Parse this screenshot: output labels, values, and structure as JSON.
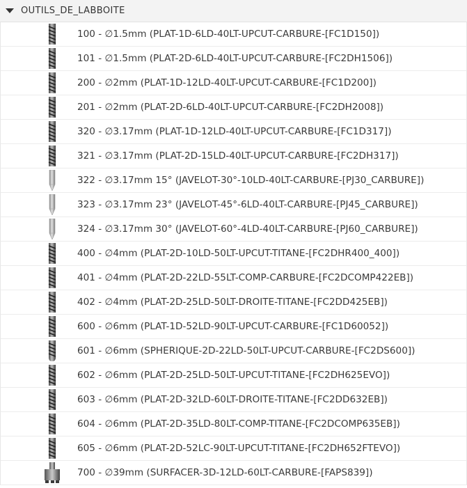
{
  "group": {
    "name": "OUTILS_DE_LABBOITE",
    "expanded": true
  },
  "colors": {
    "header_bg": "#f3f3f3",
    "row_border": "#ececec",
    "text": "#3a3a3a"
  },
  "tools": [
    {
      "label": "100 - ∅1.5mm (PLAT-1D-6LD-40LT-UPCUT-CARBURE-[FC1D150])",
      "icon": "flat-endmill-icon"
    },
    {
      "label": "101 - ∅1.5mm (PLAT-2D-6LD-40LT-UPCUT-CARBURE-[FC2DH1506])",
      "icon": "flat-endmill-icon"
    },
    {
      "label": "200 - ∅2mm (PLAT-1D-12LD-40LT-UPCUT-CARBURE-[FC1D200])",
      "icon": "flat-endmill-icon"
    },
    {
      "label": "201 - ∅2mm (PLAT-2D-6LD-40LT-UPCUT-CARBURE-[FC2DH2008])",
      "icon": "flat-endmill-icon"
    },
    {
      "label": "320 - ∅3.17mm (PLAT-1D-12LD-40LT-UPCUT-CARBURE-[FC1D317])",
      "icon": "flat-endmill-icon"
    },
    {
      "label": "321 - ∅3.17mm (PLAT-2D-15LD-40LT-UPCUT-CARBURE-[FC2DH317])",
      "icon": "flat-endmill-icon"
    },
    {
      "label": "322 - ∅3.17mm 15° (JAVELOT-30°-10LD-40LT-CARBURE-[PJ30_CARBURE])",
      "icon": "engraving-tool-icon"
    },
    {
      "label": "323 - ∅3.17mm 23° (JAVELOT-45°-6LD-40LT-CARBURE-[PJ45_CARBURE])",
      "icon": "engraving-tool-icon"
    },
    {
      "label": "324 - ∅3.17mm 30° (JAVELOT-60°-4LD-40LT-CARBURE-[PJ60_CARBURE])",
      "icon": "engraving-tool-icon"
    },
    {
      "label": "400 - ∅4mm (PLAT-2D-10LD-50LT-UPCUT-TITANE-[FC2DHR400_400])",
      "icon": "flat-endmill-icon"
    },
    {
      "label": "401 - ∅4mm (PLAT-2D-22LD-55LT-COMP-CARBURE-[FC2DCOMP422EB])",
      "icon": "flat-endmill-icon"
    },
    {
      "label": "402 - ∅4mm (PLAT-2D-25LD-50LT-DROITE-TITANE-[FC2DD425EB])",
      "icon": "flat-endmill-icon"
    },
    {
      "label": "600 - ∅6mm (PLAT-1D-52LD-90LT-UPCUT-CARBURE-[FC1D60052])",
      "icon": "flat-endmill-icon"
    },
    {
      "label": "601 - ∅6mm (SPHERIQUE-2D-22LD-50LT-UPCUT-CARBURE-[FC2DS600])",
      "icon": "ball-endmill-icon"
    },
    {
      "label": "602 - ∅6mm (PLAT-2D-25LD-50LT-UPCUT-TITANE-[FC2DH625EVO])",
      "icon": "flat-endmill-icon"
    },
    {
      "label": "603 - ∅6mm (PLAT-2D-32LD-60LT-DROITE-TITANE-[FC2DD632EB])",
      "icon": "flat-endmill-icon"
    },
    {
      "label": "604 - ∅6mm (PLAT-2D-35LD-80LT-COMP-TITANE-[FC2DCOMP635EB])",
      "icon": "flat-endmill-icon"
    },
    {
      "label": "605 - ∅6mm (PLAT-2D-52LC-90LT-UPCUT-TITANE-[FC2DH652FTEVO])",
      "icon": "flat-endmill-icon"
    },
    {
      "label": "700 - ∅39mm (SURFACER-3D-12LD-60LT-CARBURE-[FAPS839])",
      "icon": "face-mill-icon"
    }
  ]
}
